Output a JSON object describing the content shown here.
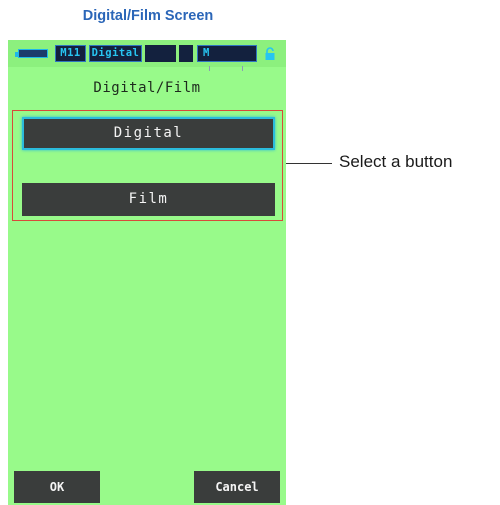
{
  "doc_title": "Digital/Film Screen",
  "statusbar": {
    "mode_badge": "M11",
    "mode_label": "Digital",
    "meter_marker": "M",
    "icons": [
      "battery-icon",
      "lock-icon"
    ]
  },
  "screen": {
    "title": "Digital/Film",
    "options": [
      {
        "label": "Digital",
        "selected": true
      },
      {
        "label": "Film",
        "selected": false
      }
    ],
    "ok_label": "OK",
    "cancel_label": "Cancel"
  },
  "callout": {
    "text": "Select a button"
  },
  "colors": {
    "screen_bg": "#98fa8a",
    "button_bg": "#3a3d3c",
    "selected_outline": "#2bbcdc",
    "callout_box": "#d84a3a",
    "title_blue": "#2b66b8"
  }
}
